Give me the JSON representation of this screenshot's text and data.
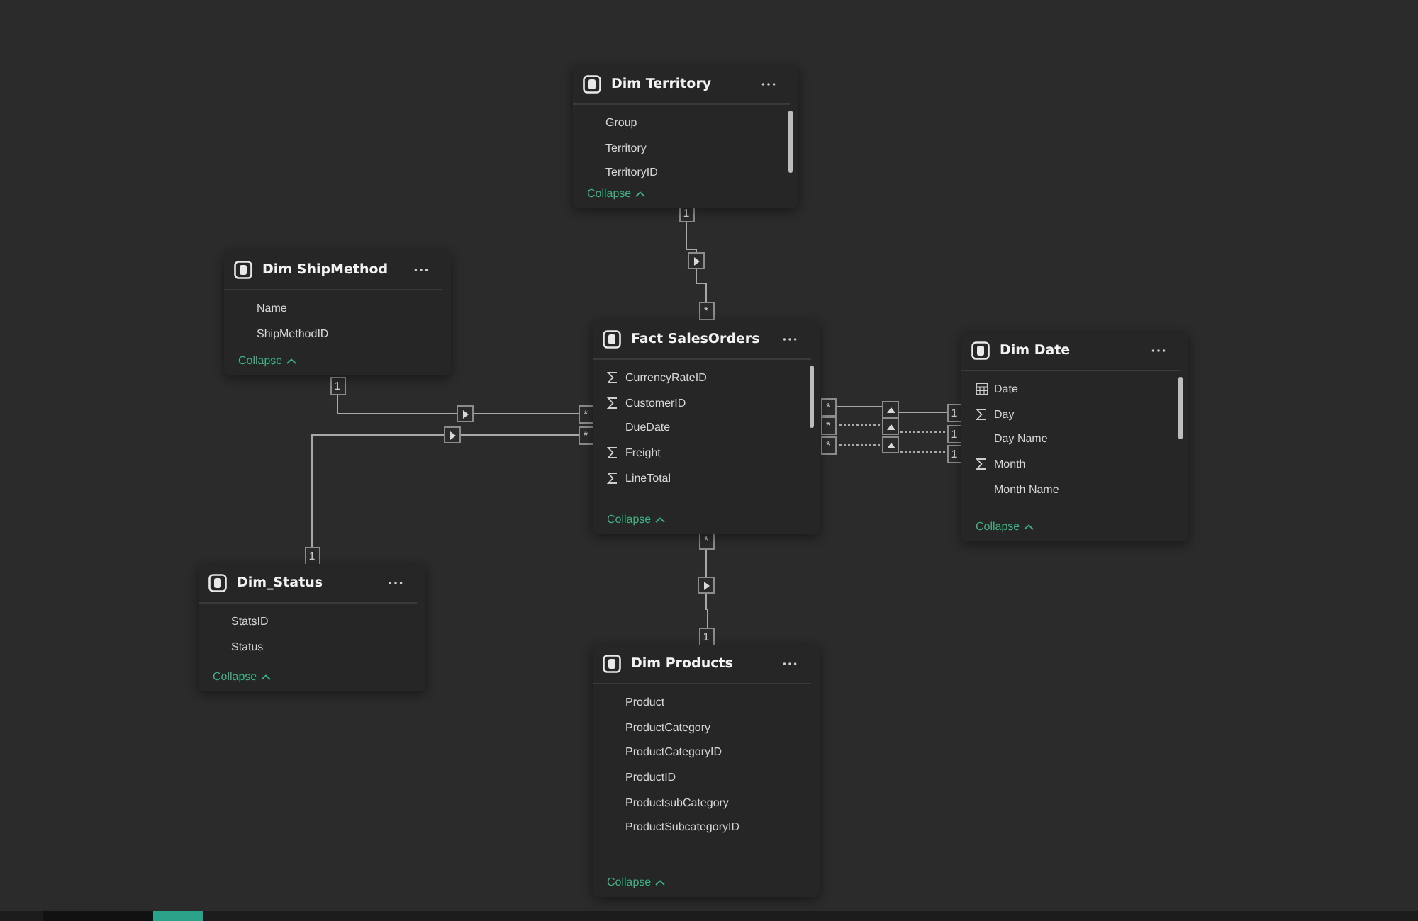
{
  "tables": [
    {
      "title": "Dim Territory",
      "scrollbar": true,
      "collapse": "Collapse",
      "fields": [
        {
          "name": "Group",
          "kind": "plain"
        },
        {
          "name": "Territory",
          "kind": "plain"
        },
        {
          "name": "TerritoryID",
          "kind": "plain"
        }
      ]
    },
    {
      "title": "Dim ShipMethod",
      "scrollbar": false,
      "collapse": "Collapse",
      "fields": [
        {
          "name": "Name",
          "kind": "plain"
        },
        {
          "name": "ShipMethodID",
          "kind": "plain"
        }
      ]
    },
    {
      "title": "Fact SalesOrders",
      "scrollbar": true,
      "collapse": "Collapse",
      "fields": [
        {
          "name": "CurrencyRateID",
          "kind": "sum"
        },
        {
          "name": "CustomerID",
          "kind": "sum"
        },
        {
          "name": "DueDate",
          "kind": "plain"
        },
        {
          "name": "Freight",
          "kind": "sum"
        },
        {
          "name": "LineTotal",
          "kind": "sum"
        }
      ]
    },
    {
      "title": "Dim Date",
      "scrollbar": true,
      "collapse": "Collapse",
      "fields": [
        {
          "name": "Date",
          "kind": "date"
        },
        {
          "name": "Day",
          "kind": "sum"
        },
        {
          "name": "Day Name",
          "kind": "plain"
        },
        {
          "name": "Month",
          "kind": "sum"
        },
        {
          "name": "Month Name",
          "kind": "plain"
        }
      ]
    },
    {
      "title": "Dim_Status",
      "scrollbar": false,
      "collapse": "Collapse",
      "fields": [
        {
          "name": "StatsID",
          "kind": "plain"
        },
        {
          "name": "Status",
          "kind": "plain"
        }
      ]
    },
    {
      "title": "Dim Products",
      "scrollbar": false,
      "collapse": "Collapse",
      "fields": [
        {
          "name": "Product",
          "kind": "plain"
        },
        {
          "name": "ProductCategory",
          "kind": "plain"
        },
        {
          "name": "ProductCategoryID",
          "kind": "plain"
        },
        {
          "name": "ProductID",
          "kind": "plain"
        },
        {
          "name": "ProductsubCategory",
          "kind": "plain"
        },
        {
          "name": "ProductSubcategoryID",
          "kind": "plain"
        }
      ]
    }
  ],
  "relationships": [
    {
      "one": "1",
      "many": "*",
      "active": true
    },
    {
      "one": "1",
      "many": "*",
      "active": true
    },
    {
      "one": "1",
      "many": "*",
      "active": true
    },
    {
      "one": "1",
      "many": "*",
      "active": true
    },
    {
      "one": "1",
      "many": "*",
      "active": false
    },
    {
      "one": "1",
      "many": "*",
      "active": false
    },
    {
      "one": "1",
      "many": "*",
      "active": true
    }
  ]
}
